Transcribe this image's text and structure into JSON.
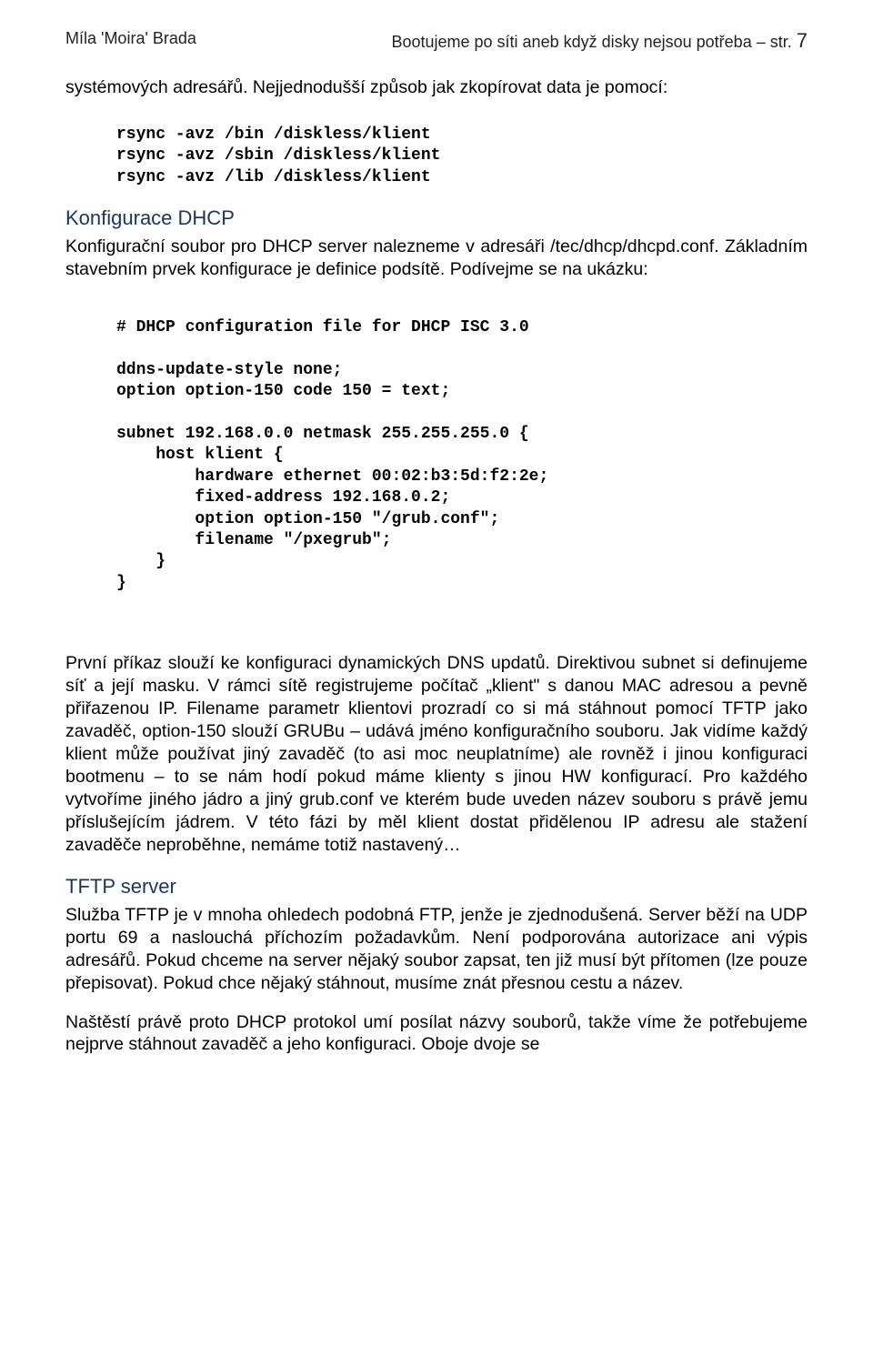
{
  "header": {
    "author": "Míla 'Moira' Brada",
    "title": "Bootujeme po síti aneb když disky nejsou potřeba – str.",
    "page": "7"
  },
  "para1": "systémových adresářů. Nejjednodušší způsob jak zkopírovat data je pomocí:",
  "code1": "rsync -avz /bin /diskless/klient\nrsync -avz /sbin /diskless/klient\nrsync -avz /lib /diskless/klient",
  "section1": "Konfigurace DHCP",
  "para2": "Konfigurační soubor pro DHCP server nalezneme v adresáři /tec/dhcp/dhcpd.conf. Základním stavebním prvek konfigurace je definice podsítě. Podívejme se na ukázku:",
  "code2": "# DHCP configuration file for DHCP ISC 3.0\n\nddns-update-style none;\noption option-150 code 150 = text;\n\nsubnet 192.168.0.0 netmask 255.255.255.0 {\n    host klient {\n        hardware ethernet 00:02:b3:5d:f2:2e;\n        fixed-address 192.168.0.2;\n        option option-150 \"/grub.conf\";\n        filename \"/pxegrub\";\n    }\n}",
  "para3": "První příkaz slouží ke konfiguraci dynamických DNS updatů. Direktivou subnet si definujeme síť a její masku. V rámci sítě registrujeme počítač „klient\" s danou MAC adresou a pevně přiřazenou IP. Filename parametr klientovi prozradí co si má stáhnout pomocí TFTP jako zavaděč, option-150 slouží GRUBu – udává jméno konfiguračního souboru. Jak vidíme každý klient může používat jiný zavaděč (to asi moc neuplatníme) ale rovněž i jinou konfiguraci bootmenu – to se nám hodí pokud máme klienty s jinou HW konfigurací. Pro každého vytvoříme jiného jádro a jiný grub.conf ve kterém bude uveden název souboru s právě jemu příslušejícím jádrem. V této fázi by měl klient dostat přidělenou IP adresu ale stažení zavaděče neproběhne, nemáme totiž nastavený…",
  "section2": "TFTP server",
  "para4": "Služba TFTP je v mnoha ohledech podobná FTP, jenže je zjednodušená. Server běží na UDP portu 69 a naslouchá příchozím požadavkům. Není podporována autorizace ani výpis adresářů. Pokud chceme na server nějaký soubor zapsat, ten již musí být přítomen (lze pouze přepisovat). Pokud chce nějaký stáhnout, musíme znát přesnou cestu a název.",
  "para5": "Naštěstí právě proto DHCP protokol umí posílat názvy souborů, takže víme že potřebujeme nejprve stáhnout zavaděč a jeho konfiguraci. Oboje dvoje se"
}
